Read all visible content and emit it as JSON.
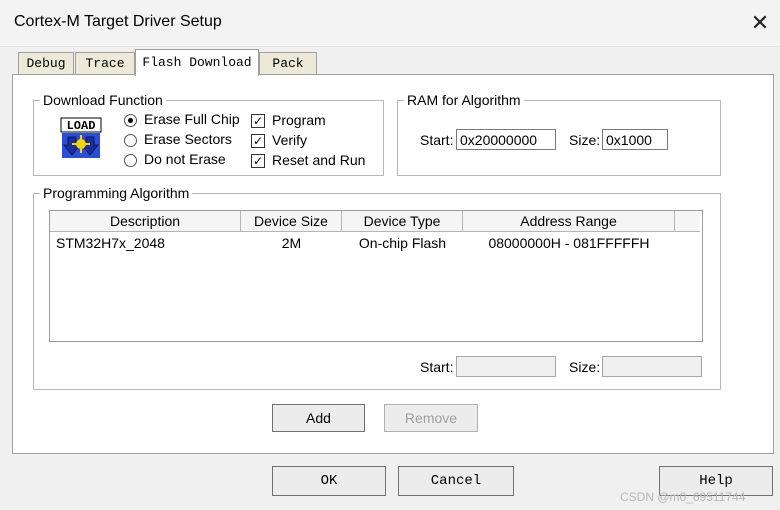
{
  "window": {
    "title": "Cortex-M Target Driver Setup",
    "close_glyph": "✕"
  },
  "tabs": [
    {
      "label": "Debug"
    },
    {
      "label": "Trace"
    },
    {
      "label": "Flash Download"
    },
    {
      "label": "Pack"
    }
  ],
  "download_function": {
    "legend": "Download Function",
    "icon_text": "LOAD",
    "erase_full_chip": "Erase Full Chip",
    "erase_sectors": "Erase Sectors",
    "do_not_erase": "Do not Erase",
    "selected": "Erase Full Chip",
    "program": "Program",
    "verify": "Verify",
    "reset_and_run": "Reset and Run",
    "checked": [
      "Program",
      "Verify",
      "Reset and Run"
    ],
    "check_glyph": "✓"
  },
  "ram": {
    "legend": "RAM for Algorithm",
    "start_label": "Start:",
    "start_value": "0x20000000",
    "size_label": "Size:",
    "size_value": "0x1000"
  },
  "programming_algorithm": {
    "legend": "Programming Algorithm",
    "columns": [
      "Description",
      "Device Size",
      "Device Type",
      "Address Range"
    ],
    "rows": [
      {
        "description": "STM32H7x_2048",
        "device_size": "2M",
        "device_type": "On-chip Flash",
        "address_range": "08000000H - 081FFFFFH"
      }
    ],
    "start_label": "Start:",
    "start_value": "",
    "size_label": "Size:",
    "size_value": ""
  },
  "buttons": {
    "add": "Add",
    "remove": "Remove",
    "ok": "OK",
    "cancel": "Cancel",
    "help": "Help"
  },
  "watermark": "CSDN @m0_69511744",
  "colors": {
    "tab_bg": "#ece9d8",
    "panel_bg": "#ffffff",
    "dialog_bg": "#f0f0f0",
    "icon_blue": "#2a4fd6",
    "icon_yellow": "#f6d500"
  }
}
